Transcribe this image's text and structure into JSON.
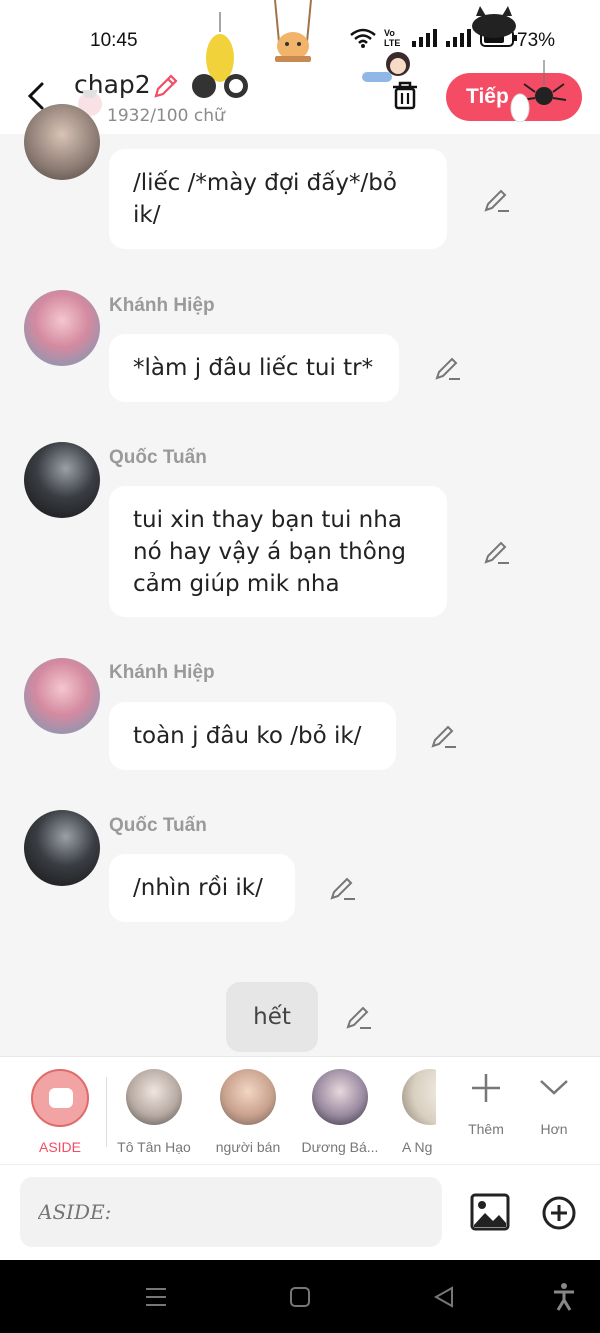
{
  "status_bar": {
    "time": "10:45",
    "battery": "73%",
    "net_label": "Vo LTE"
  },
  "header": {
    "title": "chap2",
    "word_count": "1932/100 chữ",
    "next_label": "Tiếp"
  },
  "messages": [
    {
      "sender": "",
      "text": "/liếc /*mày đợi đấy*/bỏ ik/"
    },
    {
      "sender": "Khánh Hiệp",
      "text": "*làm j đâu liếc tui tr*"
    },
    {
      "sender": "Quốc Tuấn",
      "text": "tui xin thay bạn tui nha nó hay vậy á bạn thông cảm giúp mik nha"
    },
    {
      "sender": "Khánh Hiệp",
      "text": "toàn j đâu ko /bỏ ik/"
    },
    {
      "sender": "Quốc Tuấn",
      "text": "/nhìn rồi ik/"
    }
  ],
  "end_marker": "hết",
  "characters": [
    {
      "label": "ASIDE"
    },
    {
      "label": "Tô Tân Hạo"
    },
    {
      "label": "người bán"
    },
    {
      "label": "Dương  Bá..."
    },
    {
      "label": "A Ng"
    }
  ],
  "more_label": "Thêm",
  "less_label": "Hơn",
  "input": {
    "placeholder": "ASIDE:"
  },
  "colors": {
    "accent": "#f44c64",
    "background": "#f5f5f5"
  }
}
